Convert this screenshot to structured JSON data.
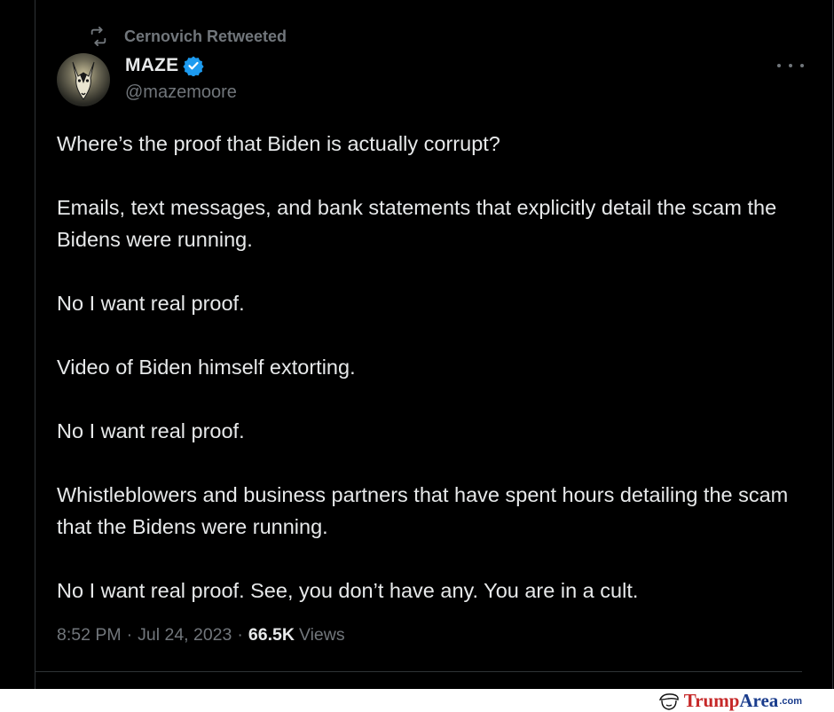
{
  "retweet": {
    "label": "Cernovich Retweeted",
    "icon": "retweet-icon"
  },
  "author": {
    "display_name": "MAZE",
    "handle": "@mazemoore",
    "verified": true,
    "verified_color": "#1d9bf0"
  },
  "tweet": {
    "paragraphs": [
      "Where’s the proof that Biden is actually corrupt?",
      "Emails, text messages, and bank statements that explicitly detail the scam the Bidens were running.",
      "No I want real proof.",
      "Video of Biden himself extorting.",
      "No I want real proof.",
      "Whistleblowers and business partners that have spent hours detailing the scam that the Bidens were running.",
      "No I want real proof. See, you don’t have any. You are in a cult."
    ]
  },
  "meta": {
    "time": "8:52 PM",
    "date": "Jul 24, 2023",
    "separator": "·",
    "views_count": "66.5K",
    "views_label": "Views"
  },
  "watermark": {
    "brand_part1": "Trump",
    "brand_part2": "Area",
    "suffix": ".com"
  },
  "colors": {
    "background": "#000000",
    "text_primary": "#e7e9ea",
    "text_secondary": "#71767b",
    "border": "#2f3336"
  }
}
